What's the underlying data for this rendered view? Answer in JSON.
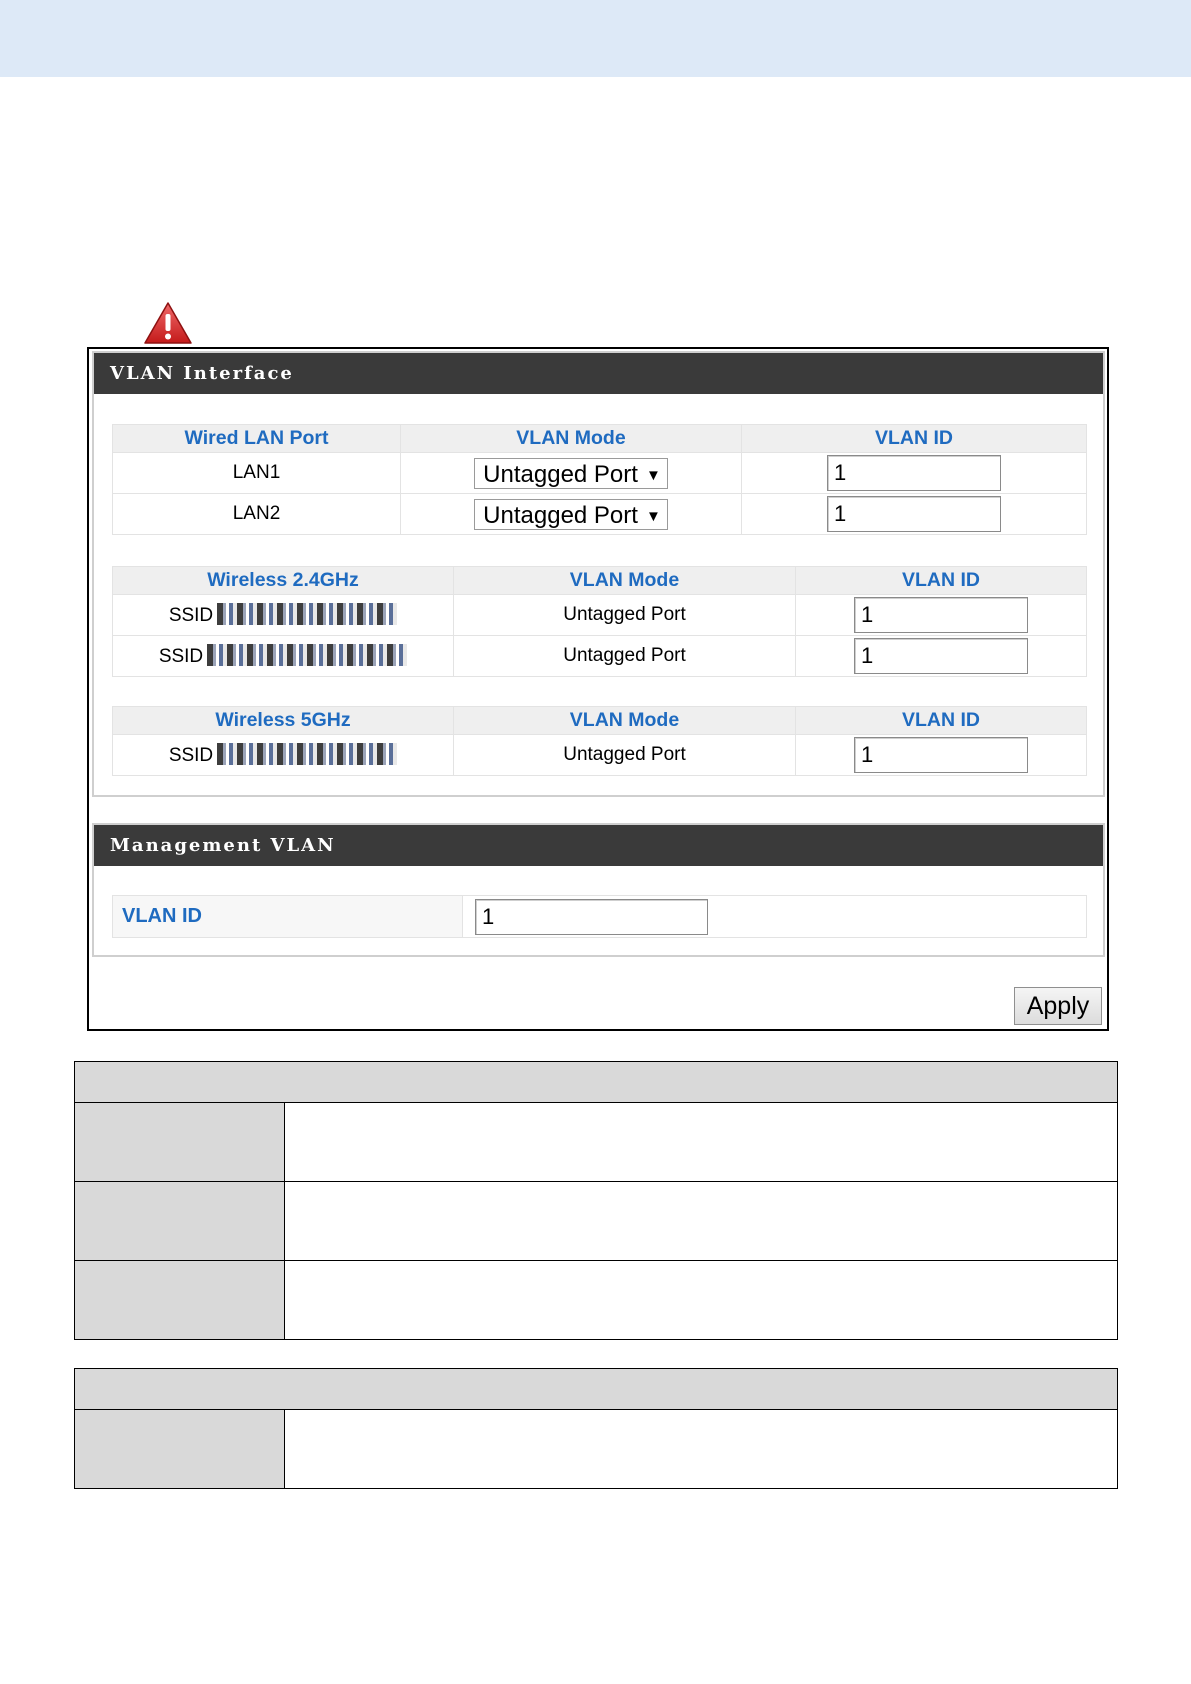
{
  "vlan_interface": {
    "title": "VLAN Interface",
    "wired": {
      "headers": [
        "Wired LAN Port",
        "VLAN Mode",
        "VLAN ID"
      ],
      "rows": [
        {
          "port": "LAN1",
          "mode": "Untagged Port",
          "vlan_id": "1"
        },
        {
          "port": "LAN2",
          "mode": "Untagged Port",
          "vlan_id": "1"
        }
      ]
    },
    "wireless24": {
      "headers": [
        "Wireless 2.4GHz",
        "VLAN Mode",
        "VLAN ID"
      ],
      "rows": [
        {
          "ssid_prefix": "SSID",
          "mode": "Untagged Port",
          "vlan_id": "1"
        },
        {
          "ssid_prefix": "SSID",
          "mode": "Untagged Port",
          "vlan_id": "1"
        }
      ]
    },
    "wireless5": {
      "headers": [
        "Wireless 5GHz",
        "VLAN Mode",
        "VLAN ID"
      ],
      "rows": [
        {
          "ssid_prefix": "SSID",
          "mode": "Untagged Port",
          "vlan_id": "1"
        }
      ]
    }
  },
  "management_vlan": {
    "title": "Management VLAN",
    "label": "VLAN ID",
    "value": "1"
  },
  "apply_label": "Apply",
  "colors": {
    "header_bar": "#3a3a3a",
    "accent_blue": "#1f6bc0",
    "top_band": "#dde9f7"
  }
}
